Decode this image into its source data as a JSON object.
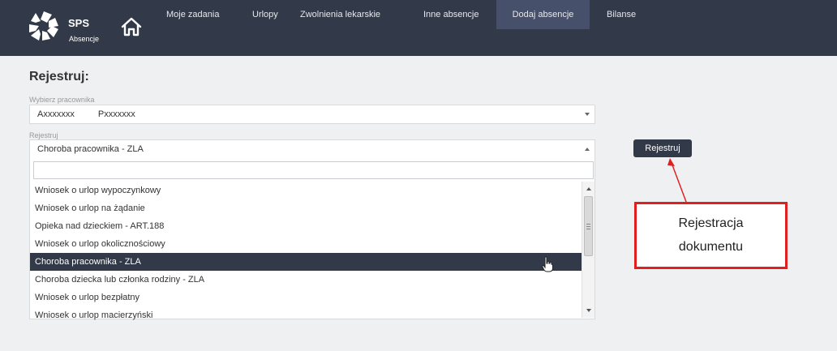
{
  "app": {
    "brand": "SPS",
    "brand_sub": "Absencje",
    "logo_icon": "sps-logo-icon",
    "home_icon": "home-icon"
  },
  "nav": {
    "items": [
      {
        "label": "Moje zadania",
        "active": false
      },
      {
        "label": "Urlopy",
        "active": false
      },
      {
        "label": "Zwolnienia lekarskie",
        "active": false
      },
      {
        "label": "Inne absencje",
        "active": false
      },
      {
        "label": "Dodaj absencje",
        "active": true
      },
      {
        "label": "Bilanse",
        "active": false
      }
    ]
  },
  "form": {
    "title": "Rejestruj:",
    "employee_label": "Wybierz pracownika",
    "employee_value_first": "Axxxxxxx",
    "employee_value_last": "Pxxxxxxx",
    "register_label": "Rejestruj",
    "register_value": "Choroba pracownika - ZLA",
    "search_value": "",
    "options": [
      "Wniosek o urlop wypoczynkowy",
      "Wniosek o urlop na żądanie",
      "Opieka nad dzieckiem - ART.188",
      "Wniosek o urlop okolicznościowy",
      "Choroba pracownika - ZLA",
      "Choroba dziecka lub członka rodziny - ZLA",
      "Wniosek o urlop bezpłatny",
      "Wniosek o urlop macierzyński"
    ],
    "selected_option": "Choroba pracownika - ZLA"
  },
  "actions": {
    "register_button": "Rejestruj"
  },
  "annotation": {
    "line1": "Rejestracja",
    "line2": "dokumentu",
    "color": "#e02020"
  },
  "colors": {
    "topbar": "#323949",
    "active_tab": "#46506a",
    "selected_row": "#323949",
    "background": "#eef0f1"
  }
}
